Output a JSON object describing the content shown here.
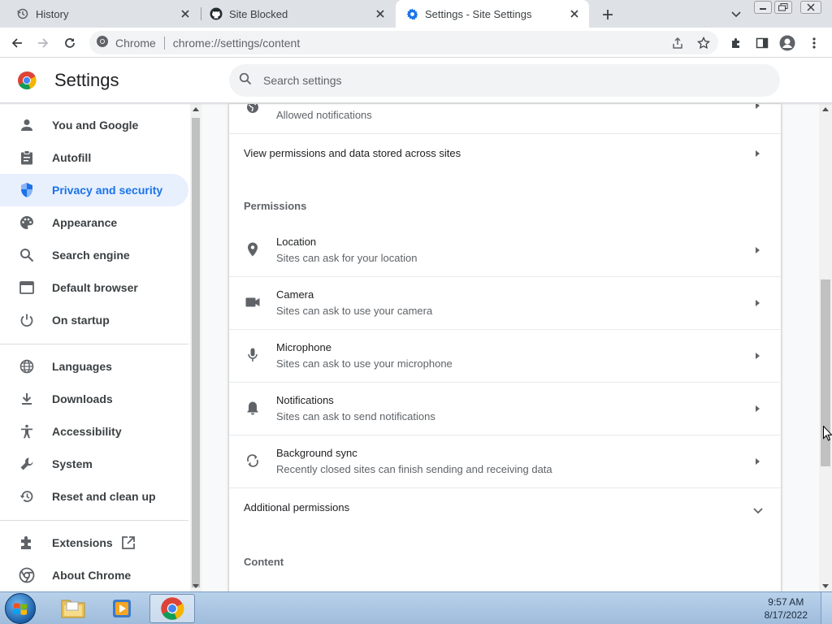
{
  "tabs": [
    {
      "title": "History",
      "icon": "history-icon",
      "active": false
    },
    {
      "title": "Site Blocked",
      "icon": "github-icon",
      "active": false
    },
    {
      "title": "Settings - Site Settings",
      "icon": "settings-gear-icon",
      "active": true
    }
  ],
  "omnibox": {
    "site_chip": "Chrome",
    "url": "chrome://settings/content"
  },
  "header": {
    "title": "Settings",
    "search_placeholder": "Search settings"
  },
  "sidebar": {
    "items": [
      {
        "label": "You and Google",
        "icon": "person-icon",
        "active": false
      },
      {
        "label": "Autofill",
        "icon": "clipboard-icon",
        "active": false
      },
      {
        "label": "Privacy and security",
        "icon": "shield-icon",
        "active": true
      },
      {
        "label": "Appearance",
        "icon": "palette-icon",
        "active": false
      },
      {
        "label": "Search engine",
        "icon": "search-icon",
        "active": false
      },
      {
        "label": "Default browser",
        "icon": "browser-window-icon",
        "active": false
      },
      {
        "label": "On startup",
        "icon": "power-icon",
        "active": false
      },
      {
        "label": "Languages",
        "icon": "globe-icon",
        "active": false
      },
      {
        "label": "Downloads",
        "icon": "download-icon",
        "active": false
      },
      {
        "label": "Accessibility",
        "icon": "accessibility-icon",
        "active": false
      },
      {
        "label": "System",
        "icon": "wrench-icon",
        "active": false
      },
      {
        "label": "Reset and clean up",
        "icon": "restore-icon",
        "active": false
      },
      {
        "label": "Extensions",
        "icon": "puzzle-icon",
        "active": false
      },
      {
        "label": "About Chrome",
        "icon": "chrome-icon",
        "active": false
      }
    ]
  },
  "content": {
    "recent_row": {
      "subtitle": "Allowed notifications"
    },
    "view_permissions_label": "View permissions and data stored across sites",
    "permissions_heading": "Permissions",
    "permissions": [
      {
        "title": "Location",
        "subtitle": "Sites can ask for your location",
        "icon": "location-pin-icon"
      },
      {
        "title": "Camera",
        "subtitle": "Sites can ask to use your camera",
        "icon": "camera-icon"
      },
      {
        "title": "Microphone",
        "subtitle": "Sites can ask to use your microphone",
        "icon": "microphone-icon"
      },
      {
        "title": "Notifications",
        "subtitle": "Sites can ask to send notifications",
        "icon": "bell-icon"
      },
      {
        "title": "Background sync",
        "subtitle": "Recently closed sites can finish sending and receiving data",
        "icon": "sync-icon"
      }
    ],
    "additional_permissions_label": "Additional permissions",
    "content_heading": "Content"
  },
  "taskbar": {
    "time": "9:57 AM",
    "date": "8/17/2022"
  },
  "colors": {
    "accent": "#1a73e8",
    "active_bg": "#e8f0fe",
    "tabstrip": "#dee1e6"
  }
}
